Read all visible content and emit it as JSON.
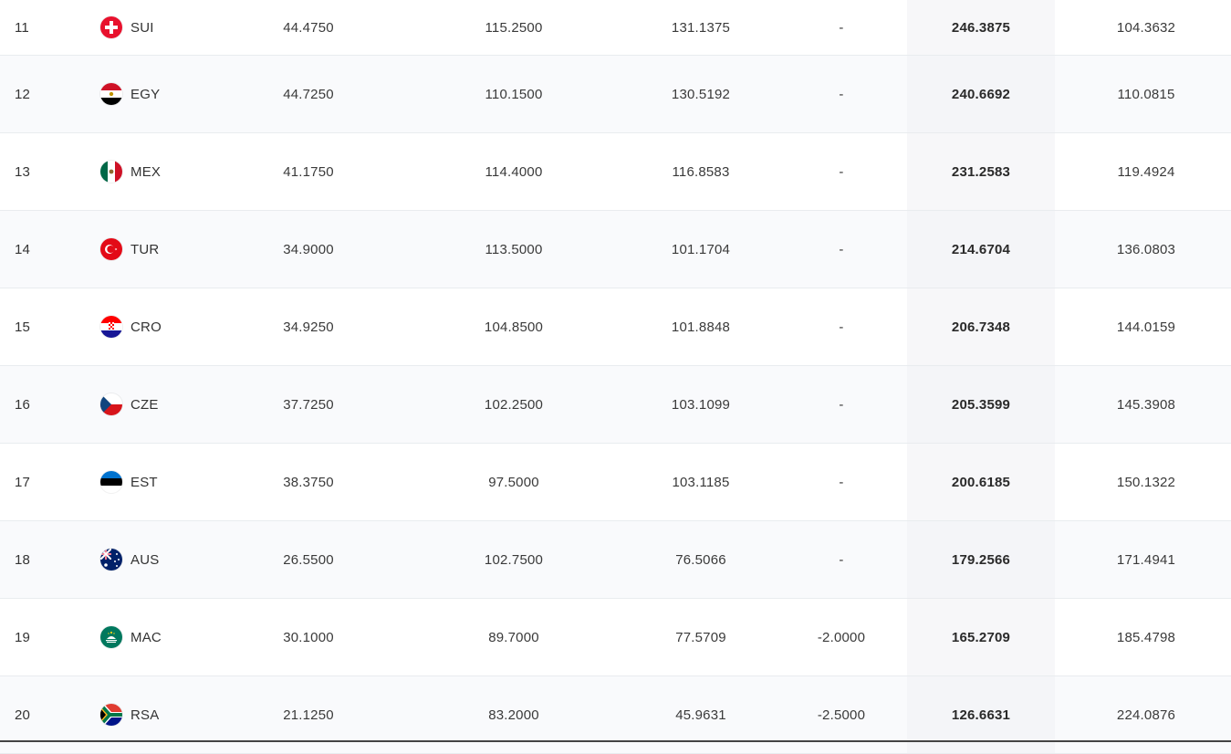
{
  "rows": [
    {
      "rank": "11",
      "code": "SUI",
      "c1": "44.4750",
      "c2": "115.2500",
      "c3": "131.1375",
      "c4": "-",
      "total": "246.3875",
      "gap": "104.3632"
    },
    {
      "rank": "12",
      "code": "EGY",
      "c1": "44.7250",
      "c2": "110.1500",
      "c3": "130.5192",
      "c4": "-",
      "total": "240.6692",
      "gap": "110.0815"
    },
    {
      "rank": "13",
      "code": "MEX",
      "c1": "41.1750",
      "c2": "114.4000",
      "c3": "116.8583",
      "c4": "-",
      "total": "231.2583",
      "gap": "119.4924"
    },
    {
      "rank": "14",
      "code": "TUR",
      "c1": "34.9000",
      "c2": "113.5000",
      "c3": "101.1704",
      "c4": "-",
      "total": "214.6704",
      "gap": "136.0803"
    },
    {
      "rank": "15",
      "code": "CRO",
      "c1": "34.9250",
      "c2": "104.8500",
      "c3": "101.8848",
      "c4": "-",
      "total": "206.7348",
      "gap": "144.0159"
    },
    {
      "rank": "16",
      "code": "CZE",
      "c1": "37.7250",
      "c2": "102.2500",
      "c3": "103.1099",
      "c4": "-",
      "total": "205.3599",
      "gap": "145.3908"
    },
    {
      "rank": "17",
      "code": "EST",
      "c1": "38.3750",
      "c2": "97.5000",
      "c3": "103.1185",
      "c4": "-",
      "total": "200.6185",
      "gap": "150.1322"
    },
    {
      "rank": "18",
      "code": "AUS",
      "c1": "26.5500",
      "c2": "102.7500",
      "c3": "76.5066",
      "c4": "-",
      "total": "179.2566",
      "gap": "171.4941"
    },
    {
      "rank": "19",
      "code": "MAC",
      "c1": "30.1000",
      "c2": "89.7000",
      "c3": "77.5709",
      "c4": "-2.0000",
      "total": "165.2709",
      "gap": "185.4798"
    },
    {
      "rank": "20",
      "code": "RSA",
      "c1": "21.1250",
      "c2": "83.2000",
      "c3": "45.9631",
      "c4": "-2.5000",
      "total": "126.6631",
      "gap": "224.0876"
    }
  ],
  "flags": {
    "SUI": "switzerland-flag-icon",
    "EGY": "egypt-flag-icon",
    "MEX": "mexico-flag-icon",
    "TUR": "turkey-flag-icon",
    "CRO": "croatia-flag-icon",
    "CZE": "czech-flag-icon",
    "EST": "estonia-flag-icon",
    "AUS": "australia-flag-icon",
    "MAC": "macau-flag-icon",
    "RSA": "south-africa-flag-icon"
  }
}
